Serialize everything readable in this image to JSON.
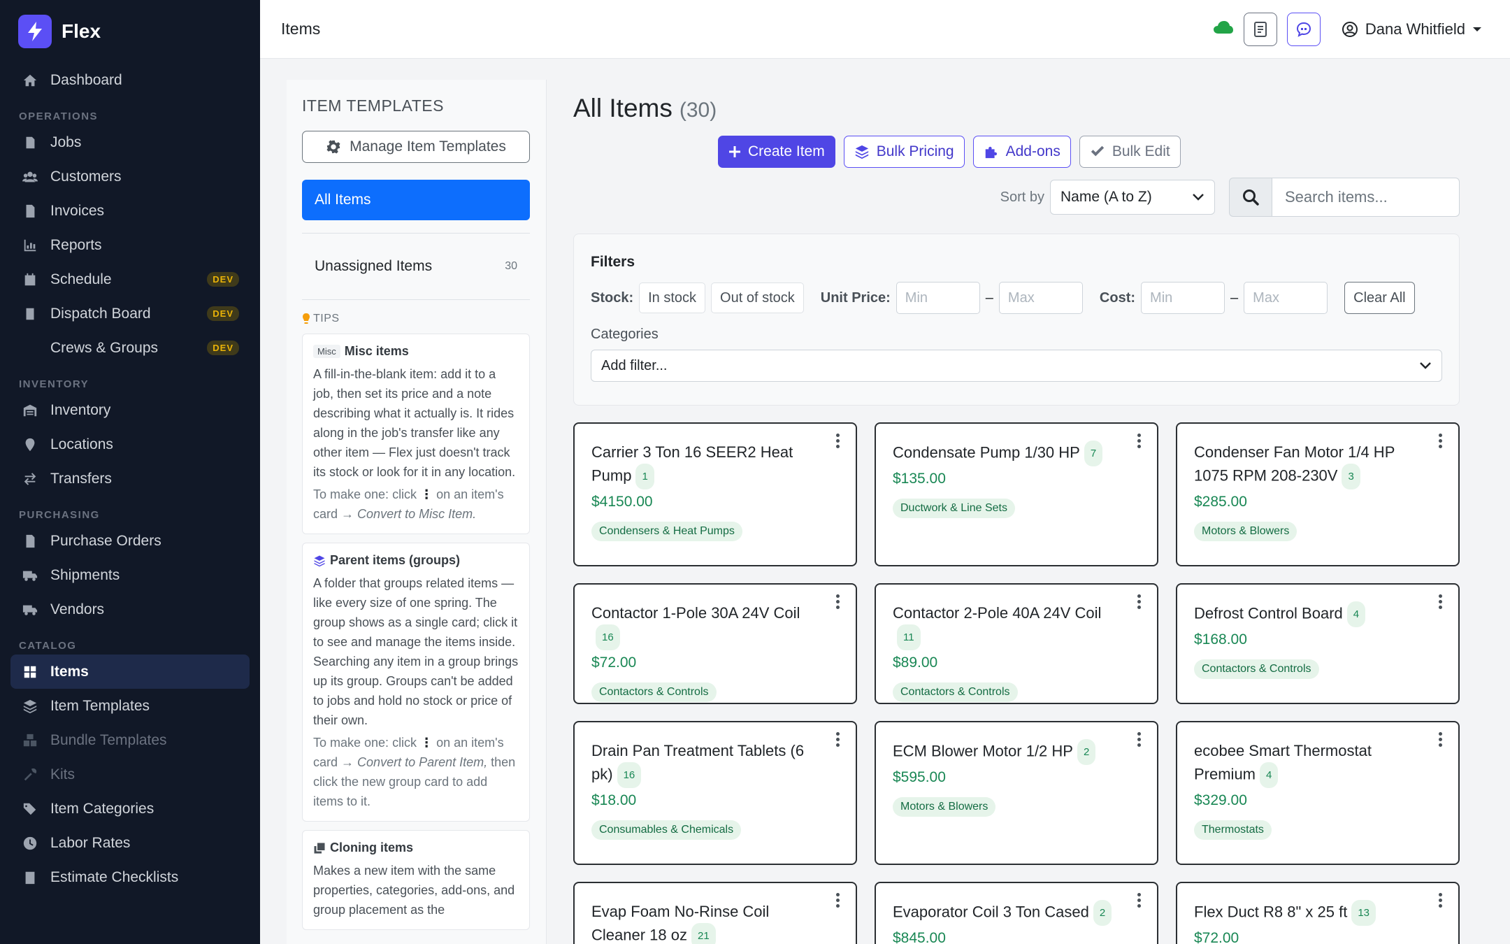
{
  "brand": {
    "name": "Flex"
  },
  "sidebar": {
    "top": [
      {
        "label": "Dashboard",
        "icon": "home-icon"
      }
    ],
    "sections": [
      {
        "title": "OPERATIONS",
        "items": [
          {
            "label": "Jobs",
            "icon": "clipboard-icon"
          },
          {
            "label": "Customers",
            "icon": "users-icon"
          },
          {
            "label": "Invoices",
            "icon": "file-invoice-icon"
          },
          {
            "label": "Reports",
            "icon": "chart-icon"
          },
          {
            "label": "Schedule",
            "icon": "calendar-icon",
            "badge": "DEV"
          },
          {
            "label": "Dispatch Board",
            "icon": "clipboard-icon",
            "badge": "DEV"
          },
          {
            "label": "Crews & Groups",
            "icon": "",
            "badge": "DEV"
          }
        ]
      },
      {
        "title": "INVENTORY",
        "items": [
          {
            "label": "Inventory",
            "icon": "warehouse-icon"
          },
          {
            "label": "Locations",
            "icon": "map-pin-icon"
          },
          {
            "label": "Transfers",
            "icon": "transfer-icon"
          }
        ]
      },
      {
        "title": "PURCHASING",
        "items": [
          {
            "label": "Purchase Orders",
            "icon": "file-icon"
          },
          {
            "label": "Shipments",
            "icon": "truck-icon"
          },
          {
            "label": "Vendors",
            "icon": "truck-icon"
          }
        ]
      },
      {
        "title": "CATALOG",
        "items": [
          {
            "label": "Items",
            "icon": "grid-icon",
            "active": true
          },
          {
            "label": "Item Templates",
            "icon": "layers-icon"
          },
          {
            "label": "Bundle Templates",
            "icon": "boxes-icon",
            "disabled": true
          },
          {
            "label": "Kits",
            "icon": "tools-icon",
            "disabled": true
          },
          {
            "label": "Item Categories",
            "icon": "tags-icon"
          },
          {
            "label": "Labor Rates",
            "icon": "clock-icon"
          },
          {
            "label": "Estimate Checklists",
            "icon": "checklist-icon"
          }
        ]
      }
    ]
  },
  "topbar": {
    "title": "Items",
    "user": "Dana Whitfield",
    "cloud_color": "#22a447"
  },
  "templates": {
    "heading": "ITEM TEMPLATES",
    "manage_label": "Manage Item Templates",
    "all_items_label": "All Items",
    "unassigned_label": "Unassigned Items",
    "unassigned_count": "30",
    "tips_label": "TIPS",
    "tips": [
      {
        "tag": "Misc",
        "title": "Misc items",
        "icon": "",
        "text": "A fill-in-the-blank item: add it to a job, then set its price and a note describing what it actually is. It rides along in the job's transfer like any other item — Flex just doesn't track its stock or look for it in any location.",
        "hint_a": "To make one: click",
        "hint_b": "on an item's card →",
        "hint_em": "Convert to Misc Item."
      },
      {
        "tag": "",
        "title": "Parent items (groups)",
        "icon": "layers-icon",
        "text": "A folder that groups related items — like every size of one spring. The group shows as a single card; click it to see and manage the items inside. Searching any item in a group brings up its group. Groups can't be added to jobs and hold no stock or price of their own.",
        "hint_a": "To make one: click",
        "hint_b": "on an item's card →",
        "hint_em": "Convert to Parent Item,",
        "hint_c": "then click the new group card to add items to it."
      },
      {
        "tag": "",
        "title": "Cloning items",
        "icon": "clone-icon",
        "text": "Makes a new item with the same properties, categories, add-ons, and group placement as the"
      }
    ]
  },
  "main": {
    "title": "All Items",
    "count": "(30)",
    "actions": [
      {
        "label": "Create Item",
        "icon": "plus-icon"
      },
      {
        "label": "Bulk Pricing",
        "icon": "layers-icon"
      },
      {
        "label": "Add-ons",
        "icon": "puzzle-icon"
      },
      {
        "label": "Bulk Edit",
        "icon": "check-double-icon"
      }
    ],
    "sort_label": "Sort by",
    "sort_value": "Name (A to Z)",
    "search_placeholder": "Search items..."
  },
  "filters": {
    "title": "Filters",
    "stock_label": "Stock:",
    "stock_options": [
      "In stock",
      "Out of stock"
    ],
    "unit_price_label": "Unit Price:",
    "cost_label": "Cost:",
    "min_placeholder": "Min",
    "max_placeholder": "Max",
    "dash": "–",
    "clear_label": "Clear All",
    "categories_label": "Categories",
    "categories_placeholder": "Add filter..."
  },
  "items": [
    {
      "name": "Carrier 3 Ton 16 SEER2 Heat Pump",
      "qty": "1",
      "price": "$4150.00",
      "category": "Condensers & Heat Pumps"
    },
    {
      "name": "Condensate Pump 1/30 HP",
      "qty": "7",
      "price": "$135.00",
      "category": "Ductwork & Line Sets"
    },
    {
      "name": "Condenser Fan Motor 1/4 HP 1075 RPM 208-230V",
      "qty": "3",
      "price": "$285.00",
      "category": "Motors & Blowers"
    },
    {
      "name": "Contactor 1-Pole 30A 24V Coil",
      "qty": "16",
      "price": "$72.00",
      "category": "Contactors & Controls"
    },
    {
      "name": "Contactor 2-Pole 40A 24V Coil",
      "qty": "11",
      "price": "$89.00",
      "category": "Contactors & Controls"
    },
    {
      "name": "Defrost Control Board",
      "qty": "4",
      "price": "$168.00",
      "category": "Contactors & Controls"
    },
    {
      "name": "Drain Pan Treatment Tablets (6 pk)",
      "qty": "16",
      "price": "$18.00",
      "category": "Consumables & Chemicals"
    },
    {
      "name": "ECM Blower Motor 1/2 HP",
      "qty": "2",
      "price": "$595.00",
      "category": "Motors & Blowers"
    },
    {
      "name": "ecobee Smart Thermostat Premium",
      "qty": "4",
      "price": "$329.00",
      "category": "Thermostats"
    },
    {
      "name": "Evap Foam No-Rinse Coil Cleaner 18 oz",
      "qty": "21",
      "price": "",
      "category": ""
    },
    {
      "name": "Evaporator Coil 3 Ton Cased",
      "qty": "2",
      "price": "$845.00",
      "category": ""
    },
    {
      "name": "Flex Duct R8 8\" x 25 ft",
      "qty": "13",
      "price": "$72.00",
      "category": ""
    }
  ]
}
